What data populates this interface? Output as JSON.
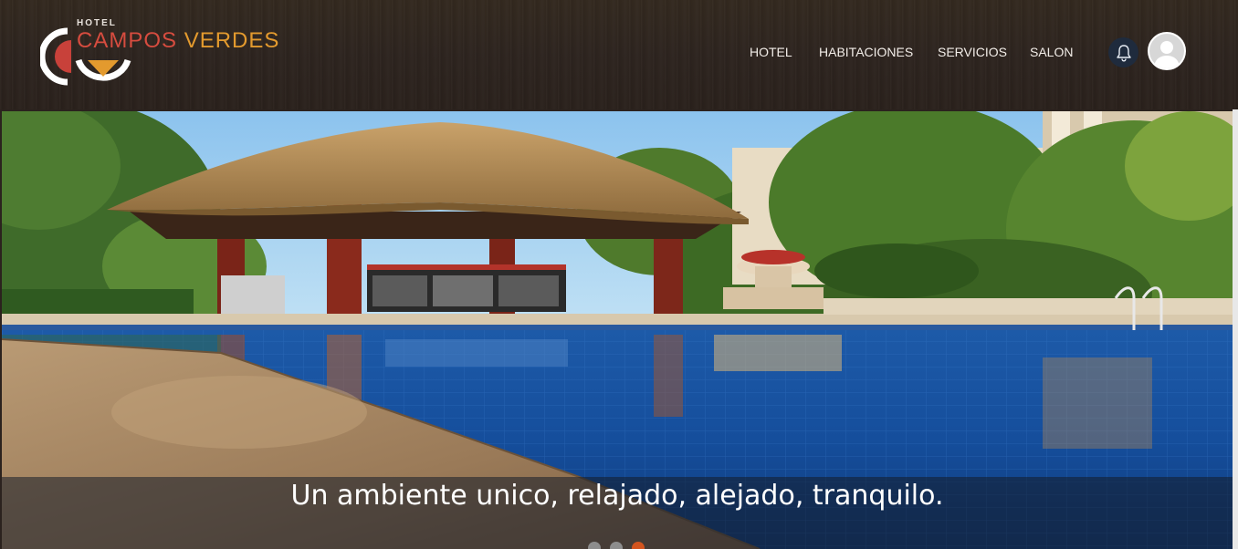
{
  "logo": {
    "small_text": "HOTEL",
    "name_part1": "CAMPOS",
    "name_part2": "VERDES"
  },
  "nav": {
    "items": [
      {
        "label": "HOTEL"
      },
      {
        "label": "HABITACIONES"
      },
      {
        "label": "SERVICIOS"
      },
      {
        "label": "SALON"
      }
    ]
  },
  "icons": {
    "notifications": "bell-icon",
    "user": "user-avatar-icon"
  },
  "hero": {
    "caption": "Un ambiente unico, relajado, alejado, tranquilo.",
    "carousel": {
      "slide_count": 3,
      "active_index": 2
    }
  },
  "colors": {
    "header_bg": "#2d241f",
    "brand_red": "#d64c3f",
    "brand_orange": "#e39a2e",
    "nav_text": "#f2ede8",
    "bell_bg": "#1f2b3d",
    "dot_active": "#d2541e",
    "dot_inactive": "#8d8d8d"
  }
}
